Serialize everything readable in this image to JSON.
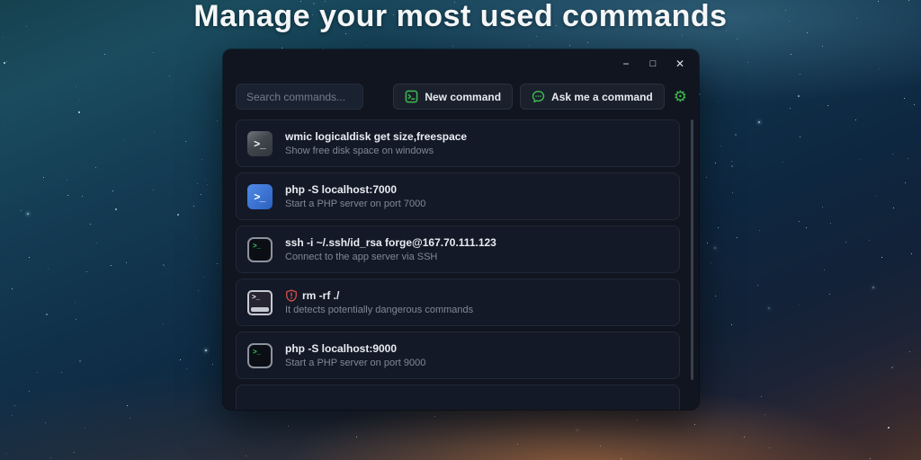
{
  "page": {
    "title": "Manage your most used commands"
  },
  "window": {
    "controls": {
      "minimize": "−",
      "maximize": "□",
      "close": "✕"
    },
    "toolbar": {
      "search_placeholder": "Search commands...",
      "new_command_label": "New command",
      "ask_command_label": "Ask me a command",
      "gear_icon": "⚙"
    },
    "colors": {
      "accent_green": "#3fb950",
      "danger_red": "#e5534b",
      "powershell_blue": "#3b74d6",
      "window_bg": "#10151f",
      "card_bg": "#141927"
    },
    "commands": [
      {
        "icon": "cmd-terminal-icon",
        "title": "wmic logicaldisk get size,freespace",
        "subtitle": "Show free disk space on windows",
        "dangerous": false
      },
      {
        "icon": "powershell-icon",
        "title": "php -S localhost:7000",
        "subtitle": "Start a PHP server on port 7000",
        "dangerous": false
      },
      {
        "icon": "dark-terminal-icon",
        "title": "ssh -i ~/.ssh/id_rsa forge@167.70.111.123",
        "subtitle": "Connect to the app server via SSH",
        "dangerous": false
      },
      {
        "icon": "light-terminal-icon",
        "title": "rm -rf ./",
        "subtitle": "It detects potentially dangerous commands",
        "dangerous": true
      },
      {
        "icon": "dark-terminal-icon",
        "title": "php -S localhost:9000",
        "subtitle": "Start a PHP server on port 9000",
        "dangerous": false
      }
    ]
  }
}
